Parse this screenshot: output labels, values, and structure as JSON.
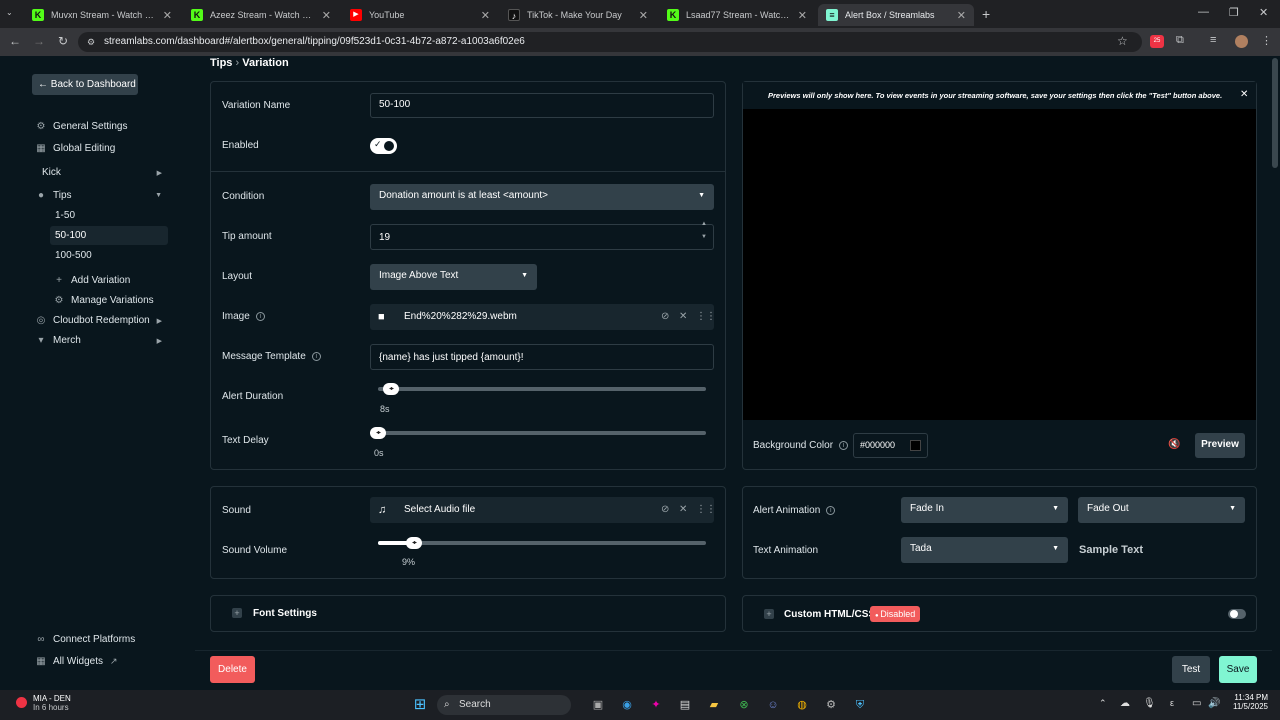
{
  "browser": {
    "tabs": [
      {
        "title": "Muvxn Stream - Watch Live on",
        "favicon": "kick-logo-icon"
      },
      {
        "title": "Azeez Stream - Watch Live on K",
        "favicon": "kick-logo-icon"
      },
      {
        "title": "YouTube",
        "favicon": "youtube-logo-icon"
      },
      {
        "title": "TikTok - Make Your Day",
        "favicon": "tiktok-logo-icon"
      },
      {
        "title": "Lsaad77 Stream - Watch Live or",
        "favicon": "kick-logo-icon"
      },
      {
        "title": "Alert Box / Streamlabs",
        "favicon": "streamlabs-logo-icon",
        "active": true
      }
    ],
    "url": "streamlabs.com/dashboard#/alertbox/general/tipping/09f523d1-0c31-4b72-a872-a1003a6f02e6",
    "ext_badge": "25"
  },
  "sidebar": {
    "back": "Back to Dashboard",
    "general_settings": "General Settings",
    "global_editing": "Global Editing",
    "kick": "Kick",
    "tips": "Tips",
    "variations": [
      "1-50",
      "50-100",
      "100-500"
    ],
    "add_variation": "Add Variation",
    "manage_variations": "Manage Variations",
    "cloudbot": "Cloudbot Redemption",
    "merch": "Merch",
    "connect_platforms": "Connect Platforms",
    "all_widgets": "All Widgets"
  },
  "breadcrumb": {
    "parent": "Tips",
    "sep": "›",
    "current": "Variation"
  },
  "form": {
    "variation_name_label": "Variation Name",
    "variation_name_value": "50-100",
    "enabled_label": "Enabled",
    "condition_label": "Condition",
    "condition_value": "Donation amount is at least <amount>",
    "tip_amount_label": "Tip amount",
    "tip_amount_value": "19",
    "layout_label": "Layout",
    "layout_value": "Image Above Text",
    "image_label": "Image",
    "image_value": "End%20%282%29.webm",
    "message_template_label": "Message Template",
    "message_template_value": "{name} has just tipped {amount}!",
    "alert_duration_label": "Alert Duration",
    "alert_duration_value": "8s",
    "alert_duration_fraction": 0.02,
    "text_delay_label": "Text Delay",
    "text_delay_value": "0s",
    "text_delay_fraction": 0.0
  },
  "sound": {
    "sound_label": "Sound",
    "sound_value": "Select Audio file",
    "volume_label": "Sound Volume",
    "volume_value": "9%",
    "volume_fraction": 0.09
  },
  "font_settings": "Font Settings",
  "preview": {
    "notice": "Previews will only show here. To view events in your streaming software, save your settings then click the \"Test\" button above.",
    "bg_color_label": "Background Color",
    "bg_color_value": "#000000",
    "preview_button": "Preview"
  },
  "animation": {
    "alert_label": "Alert Animation",
    "alert_in": "Fade In",
    "alert_out": "Fade Out",
    "text_label": "Text Animation",
    "text_value": "Tada",
    "sample": "Sample Text"
  },
  "custom": {
    "label": "Custom HTML/CSS",
    "badge": "Disabled"
  },
  "footer": {
    "delete": "Delete",
    "test": "Test",
    "save": "Save"
  },
  "taskbar": {
    "weather_team": "MIA - DEN",
    "weather_sub": "In 6 hours",
    "search": "Search",
    "time": "11:34 PM",
    "date": "11/5/2025"
  },
  "colors": {
    "accent": "#80f5d2",
    "danger": "#f25c5c",
    "bg": "#09161d"
  }
}
